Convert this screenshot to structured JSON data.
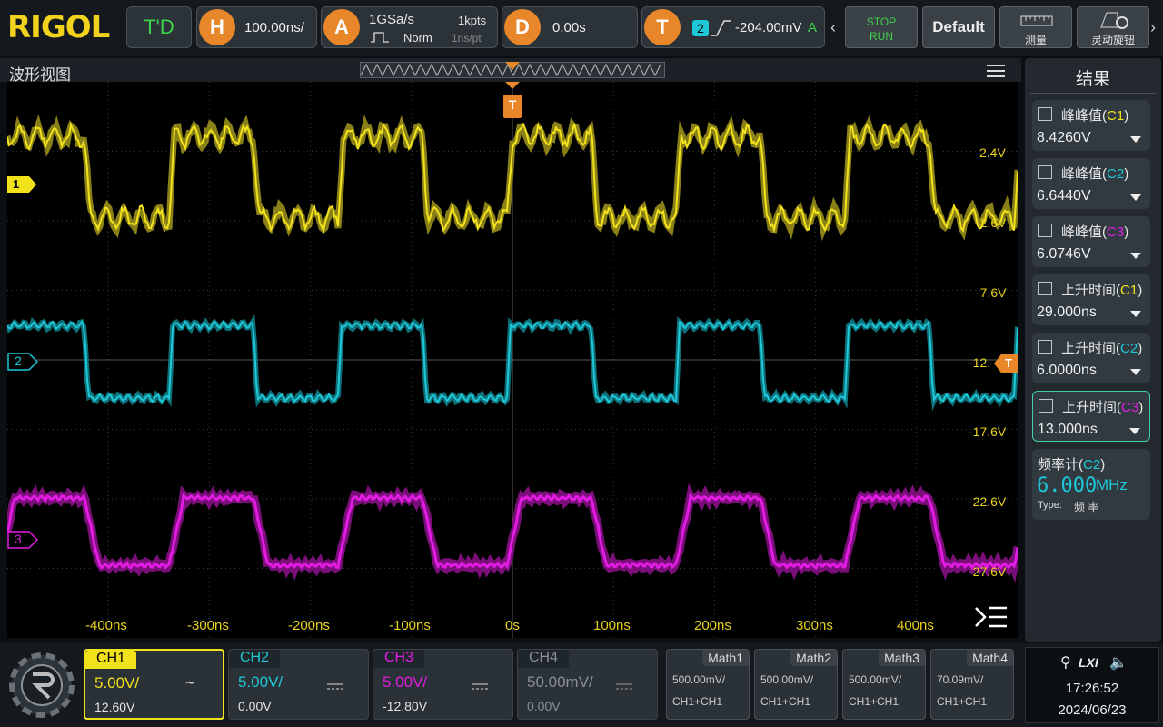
{
  "brand": "RIGOL",
  "top": {
    "td_label": "T'D",
    "horiz": {
      "letter": "H",
      "scale": "100.00ns/"
    },
    "acq": {
      "letter": "A",
      "rate": "1GSa/s",
      "mode": "Norm",
      "points": "1kpts",
      "res": "1ns/pt"
    },
    "delay": {
      "letter": "D",
      "value": "0.00s"
    },
    "trig": {
      "letter": "T",
      "channel": "2",
      "level": "-204.00mV",
      "mode_letter": "A"
    },
    "stop_run": {
      "stop": "STOP",
      "run": "RUN"
    },
    "default_btn": "Default",
    "measure_btn": "测量",
    "knob_btn": "灵动旋钮"
  },
  "wave": {
    "title": "波形视图",
    "trigger_marker": "T",
    "volt_labels": [
      "2.4V",
      "-2.6V",
      "-7.6V",
      "-12.",
      "-17.6V",
      "-22.6V",
      "-27.6V"
    ],
    "time_labels": [
      "-400ns",
      "-300ns",
      "-200ns",
      "-100ns",
      "0s",
      "100ns",
      "200ns",
      "300ns",
      "400ns"
    ],
    "ch_markers": [
      "1",
      "2",
      "3"
    ],
    "right_trig_marker": "T"
  },
  "results": {
    "title": "结果",
    "items": [
      {
        "name": "峰峰值",
        "ch": "C1",
        "value": "8.4260V"
      },
      {
        "name": "峰峰值",
        "ch": "C2",
        "value": "6.6440V"
      },
      {
        "name": "峰峰值",
        "ch": "C3",
        "value": "6.0746V"
      },
      {
        "name": "上升时间",
        "ch": "C1",
        "value": "29.000ns"
      },
      {
        "name": "上升时间",
        "ch": "C2",
        "value": "6.0000ns"
      },
      {
        "name": "上升时间",
        "ch": "C3",
        "value": "13.000ns"
      }
    ],
    "counter": {
      "name": "频率计",
      "ch": "C2",
      "value": "6.000",
      "unit": "MHz",
      "type_label": "Type:",
      "type_value": "频 率"
    }
  },
  "channels": [
    {
      "label": "CH1",
      "scale": "5.00V/",
      "offset": "12.60V",
      "coupling": "~"
    },
    {
      "label": "CH2",
      "scale": "5.00V/",
      "offset": "0.00V",
      "coupling": "DC"
    },
    {
      "label": "CH3",
      "scale": "5.00V/",
      "offset": "-12.80V",
      "coupling": "DC"
    },
    {
      "label": "CH4",
      "scale": "50.00mV/",
      "offset": "0.00V",
      "coupling": "DC"
    }
  ],
  "maths": [
    {
      "label": "Math1",
      "scale": "500.00mV/",
      "op": "CH1+CH1"
    },
    {
      "label": "Math2",
      "scale": "500.00mV/",
      "op": "CH1+CH1"
    },
    {
      "label": "Math3",
      "scale": "500.00mV/",
      "op": "CH1+CH1"
    },
    {
      "label": "Math4",
      "scale": "70.09mV/",
      "op": "CH1+CH1"
    }
  ],
  "status": {
    "time": "17:26:52",
    "date": "2024/06/23",
    "lxi": "LXI"
  },
  "colors": {
    "ch1": "#f2e21c",
    "ch2": "#1ec8d8",
    "ch3": "#e21ce2",
    "ch4": "#8a9096",
    "accent": "#e8862a",
    "green": "#3fd34a"
  }
}
